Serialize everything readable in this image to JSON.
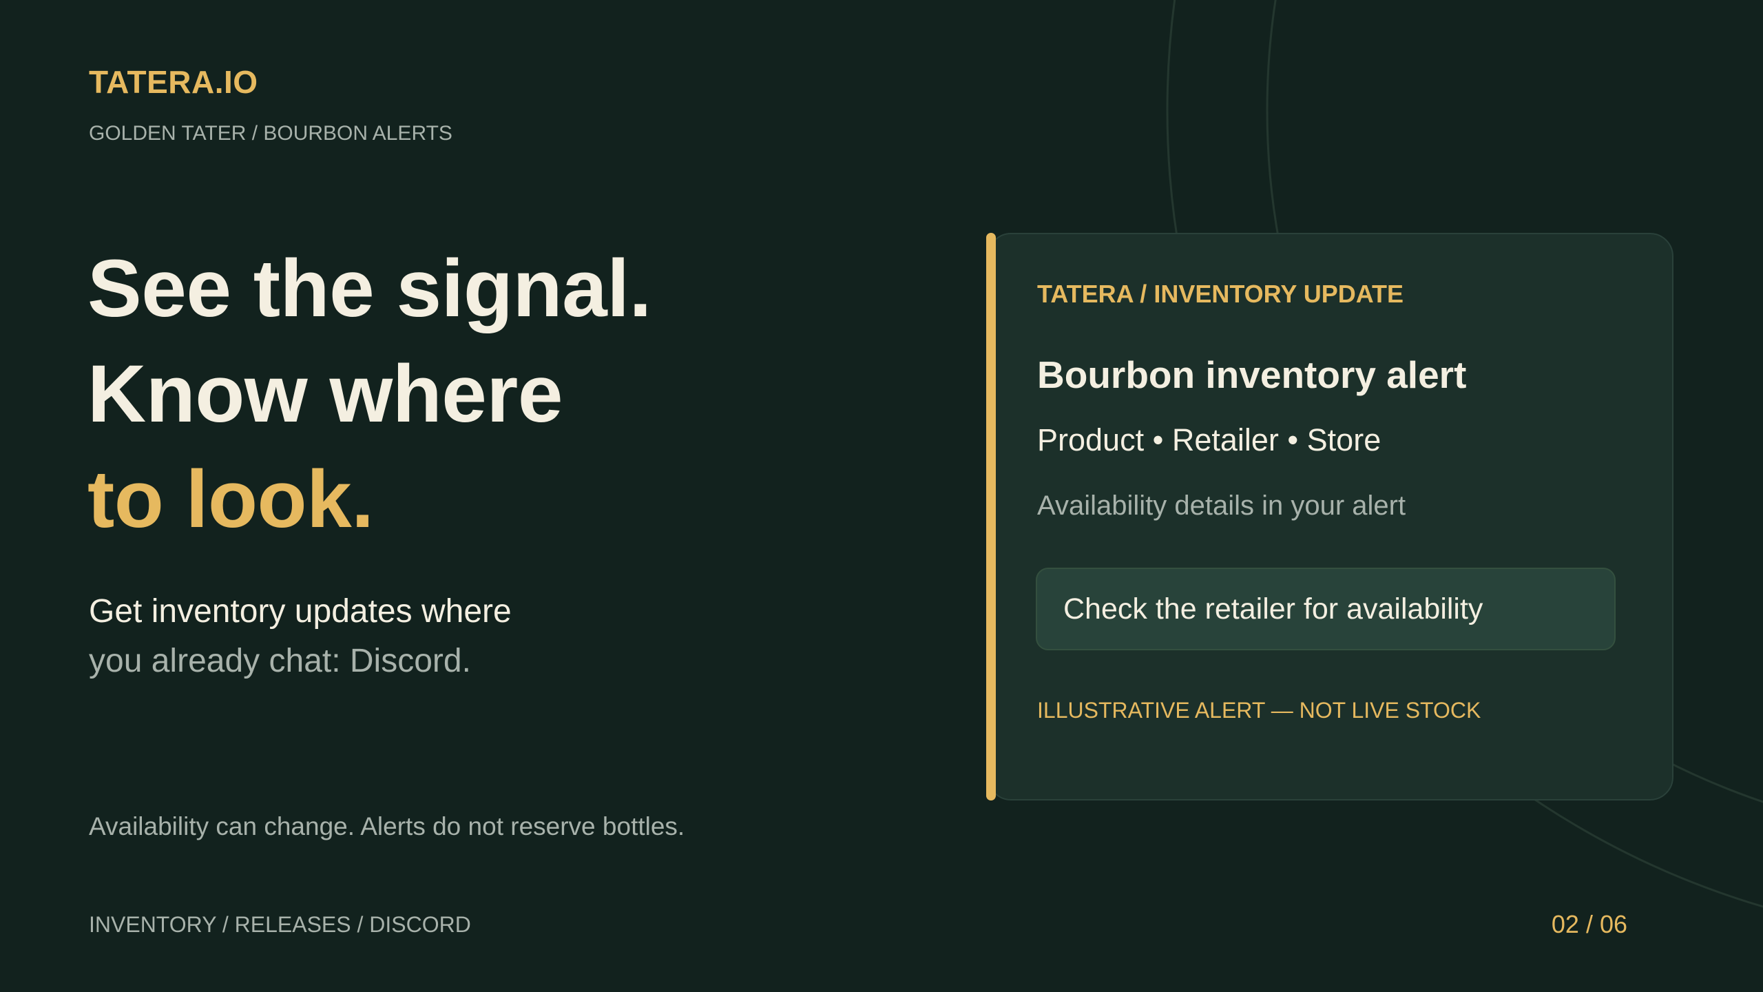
{
  "brand": {
    "name": "TATERA.IO",
    "breadcrumb": "GOLDEN TATER / BOURBON ALERTS"
  },
  "hero": {
    "line1": "See the signal.",
    "line2": "Know where",
    "line3": "to look.",
    "sub_line1": "Get inventory updates where",
    "sub_line2": "you already chat: Discord."
  },
  "disclaimer": "Availability can change. Alerts do not reserve bottles.",
  "footer": {
    "nav": "INVENTORY / RELEASES / DISCORD",
    "page": "02 / 06"
  },
  "alert_card": {
    "kicker": "TATERA / INVENTORY UPDATE",
    "title": "Bourbon inventory alert",
    "meta": "Product • Retailer • Store",
    "detail": "Availability details in your alert",
    "action": "Check the retailer for availability",
    "note": "ILLUSTRATIVE ALERT — NOT LIVE STOCK"
  },
  "colors": {
    "background": "#12221e",
    "accent": "#e6b95f",
    "text": "#f4efe1",
    "muted": "#a8b2ab",
    "card": "#1c302a"
  }
}
